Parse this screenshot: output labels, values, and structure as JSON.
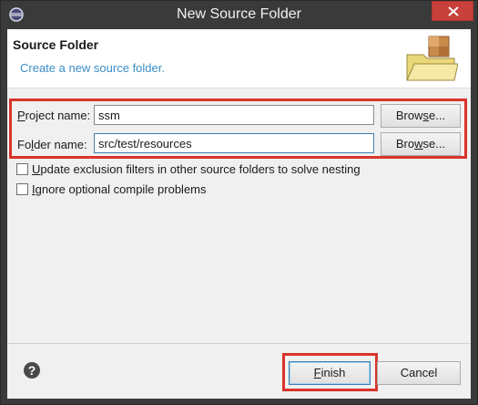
{
  "window": {
    "title": "New Source Folder"
  },
  "banner": {
    "title": "Source Folder",
    "subtitle": "Create a new source folder.",
    "icon": "source-folder-icon"
  },
  "form": {
    "project_label_mnemonic": "P",
    "project_label_rest": "roject name:",
    "project_value": "ssm",
    "folder_label_pre": "Fo",
    "folder_label_mnemonic": "l",
    "folder_label_rest": "der name:",
    "folder_value": "src/test/resources",
    "browse_pre": "Brow",
    "browse_mnemonic": "s",
    "browse_rest": "e...",
    "browse2_pre": "Bro",
    "browse2_mnemonic": "w",
    "browse2_rest": "se..."
  },
  "options": {
    "update_mnemonic": "U",
    "update_rest": "pdate exclusion filters in other source folders to solve nesting",
    "update_checked": false,
    "ignore_mnemonic": "I",
    "ignore_rest": "gnore optional compile problems",
    "ignore_checked": false
  },
  "footer": {
    "finish_mnemonic": "F",
    "finish_rest": "inish",
    "cancel_label": "Cancel",
    "help_icon": "help-icon"
  },
  "colors": {
    "highlight": "#d9342b",
    "title_bar": "#3a3a3a",
    "close_button": "#c7403b",
    "subtitle_text": "#3a8ec6"
  }
}
